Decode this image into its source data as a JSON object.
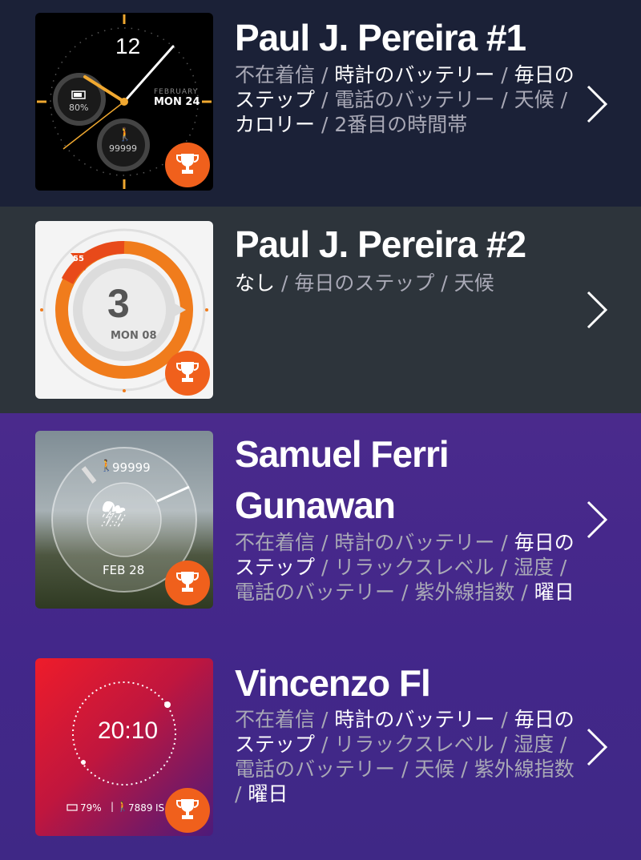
{
  "items": [
    {
      "title": "Paul J. Pereira #1",
      "features": [
        {
          "text": "不在着信",
          "on": false
        },
        {
          "text": "時計のバッテリー",
          "on": true
        },
        {
          "text": "毎日のステップ",
          "on": true
        },
        {
          "text": "電話のバッテリー",
          "on": false
        },
        {
          "text": "天候",
          "on": false
        },
        {
          "text": "カロリー",
          "on": true
        },
        {
          "text": "2番目の時間帯",
          "on": false
        }
      ],
      "preview": {
        "hour": "12",
        "month": "FEBRUARY",
        "date": "MON 24",
        "battery": "80%",
        "steps": "99999"
      }
    },
    {
      "title": "Paul J. Pereira #2",
      "features": [
        {
          "text": "なし",
          "on": true
        },
        {
          "text": "毎日のステップ",
          "on": false
        },
        {
          "text": "天候",
          "on": false
        }
      ],
      "preview": {
        "badge": "55",
        "hour": "3",
        "date": "MON 08"
      }
    },
    {
      "title_line1": "Samuel Ferri",
      "title_line2": "Gunawan",
      "features": [
        {
          "text": "不在着信",
          "on": false
        },
        {
          "text": "時計のバッテリー",
          "on": false
        },
        {
          "text": "毎日のステップ",
          "on": true
        },
        {
          "text": "リラックスレベル",
          "on": false
        },
        {
          "text": "湿度",
          "on": false
        },
        {
          "text": "電話のバッテリー",
          "on": false
        },
        {
          "text": "紫外線指数",
          "on": false
        },
        {
          "text": "曜日",
          "on": true
        }
      ],
      "preview": {
        "steps": "99999",
        "date": "FEB 28"
      }
    },
    {
      "title": "Vincenzo Fl",
      "features": [
        {
          "text": "不在着信",
          "on": false
        },
        {
          "text": "時計のバッテリー",
          "on": true
        },
        {
          "text": "毎日のステップ",
          "on": true
        },
        {
          "text": "リラックスレベル",
          "on": false
        },
        {
          "text": "湿度",
          "on": false
        },
        {
          "text": "電話のバッテリー",
          "on": false
        },
        {
          "text": "天候",
          "on": false
        },
        {
          "text": "紫外線指数",
          "on": false
        },
        {
          "text": "曜日",
          "on": true
        }
      ],
      "preview": {
        "time": "20:10",
        "battery": "79%",
        "steps": "7889",
        "extra": "IS"
      }
    }
  ],
  "colors": {
    "trophy": "#f0601c",
    "orange": "#f07c1c",
    "row1": "#1b2137",
    "row2": "#2d343b",
    "purple": "#4a2a8c"
  },
  "icons": [
    "trophy-icon",
    "chevron-right-icon",
    "battery-icon",
    "walk-icon",
    "weather-icon"
  ]
}
